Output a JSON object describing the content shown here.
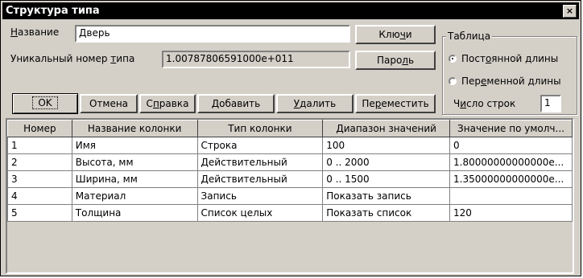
{
  "window": {
    "title": "Структура типа",
    "close": "×"
  },
  "name": {
    "label_first": "Н",
    "label_rest": "азвание",
    "value": "Дверь"
  },
  "keys_button": {
    "pre": "Клю",
    "u": "ч",
    "post": "и"
  },
  "uid": {
    "label_pre": "Уникальный номер ",
    "label_u": "т",
    "label_post": "ипа",
    "value": "1.00787806591000e+011"
  },
  "password_button": {
    "pre": "Паро",
    "u": "л",
    "post": "ь"
  },
  "table_group": {
    "legend": "Таблица",
    "radio_fixed": {
      "pre": "Пост",
      "u": "о",
      "post": "янной длины",
      "checked": true
    },
    "radio_var": {
      "pre": "Пер",
      "u": "е",
      "post": "менной длины",
      "checked": false
    },
    "rows_label": {
      "pre": "Ч",
      "u": "и",
      "post": "сло строк"
    },
    "rows_value": "1"
  },
  "buttons": {
    "ok": "OK",
    "cancel": "Отмена",
    "help": {
      "pre": "С",
      "u": "п",
      "post": "равка"
    },
    "add": {
      "pre": "",
      "u": "Д",
      "post": "обавить"
    },
    "delete": {
      "pre": "",
      "u": "У",
      "post": "далить"
    },
    "move": {
      "pre": "Пе",
      "u": "р",
      "post": "еместить"
    }
  },
  "grid": {
    "columns": [
      "Номер",
      "Название  колонки",
      "Тип колонки",
      "Диапазон значений",
      "Значение по умолч..."
    ],
    "rows": [
      [
        "1",
        "Имя",
        "Строка",
        "100",
        "0"
      ],
      [
        "2",
        "Высота, мм",
        "Действительный",
        "0 .. 2000",
        "1.80000000000000e..."
      ],
      [
        "3",
        "Ширина, мм",
        "Действительный",
        "0 .. 1500",
        "1.35000000000000e..."
      ],
      [
        "4",
        "Материал",
        "Запись",
        "Показать запись",
        ""
      ],
      [
        "5",
        "Толщина",
        "Список целых",
        "Показать список",
        "120"
      ]
    ]
  }
}
